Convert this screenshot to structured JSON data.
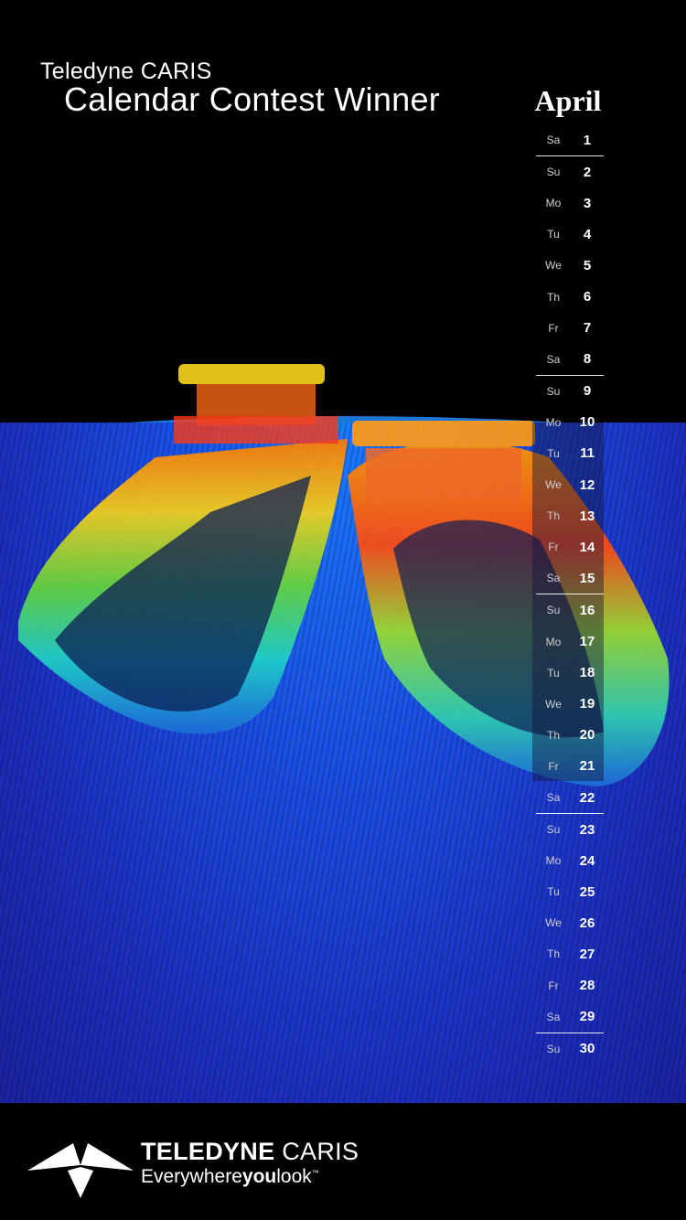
{
  "header": {
    "company": "Teledyne CARIS",
    "title": "Calendar Contest Winner"
  },
  "calendar": {
    "month": "April",
    "days": [
      {
        "dow": "Sa",
        "date": "1"
      },
      {
        "dow": "Su",
        "date": "2"
      },
      {
        "dow": "Mo",
        "date": "3"
      },
      {
        "dow": "Tu",
        "date": "4"
      },
      {
        "dow": "We",
        "date": "5"
      },
      {
        "dow": "Th",
        "date": "6"
      },
      {
        "dow": "Fr",
        "date": "7"
      },
      {
        "dow": "Sa",
        "date": "8"
      },
      {
        "dow": "Su",
        "date": "9"
      },
      {
        "dow": "Mo",
        "date": "10"
      },
      {
        "dow": "Tu",
        "date": "11"
      },
      {
        "dow": "We",
        "date": "12"
      },
      {
        "dow": "Th",
        "date": "13"
      },
      {
        "dow": "Fr",
        "date": "14"
      },
      {
        "dow": "Sa",
        "date": "15"
      },
      {
        "dow": "Su",
        "date": "16"
      },
      {
        "dow": "Mo",
        "date": "17"
      },
      {
        "dow": "Tu",
        "date": "18"
      },
      {
        "dow": "We",
        "date": "19"
      },
      {
        "dow": "Th",
        "date": "20"
      },
      {
        "dow": "Fr",
        "date": "21"
      },
      {
        "dow": "Sa",
        "date": "22"
      },
      {
        "dow": "Su",
        "date": "23"
      },
      {
        "dow": "Mo",
        "date": "24"
      },
      {
        "dow": "Tu",
        "date": "25"
      },
      {
        "dow": "We",
        "date": "26"
      },
      {
        "dow": "Th",
        "date": "27"
      },
      {
        "dow": "Fr",
        "date": "28"
      },
      {
        "dow": "Sa",
        "date": "29"
      },
      {
        "dow": "Su",
        "date": "30"
      }
    ]
  },
  "footer": {
    "brand_bold": "TELEDYNE",
    "brand_rest": " CARIS",
    "tagline_pre": "Everywhere",
    "tagline_bold": "you",
    "tagline_post": "look",
    "tagline_mark": "™"
  },
  "colors": {
    "background": "#000000",
    "seafloor": "#1c2fbf",
    "text": "#ffffff"
  },
  "icons": {
    "logo": "teledyne-logo-icon"
  }
}
